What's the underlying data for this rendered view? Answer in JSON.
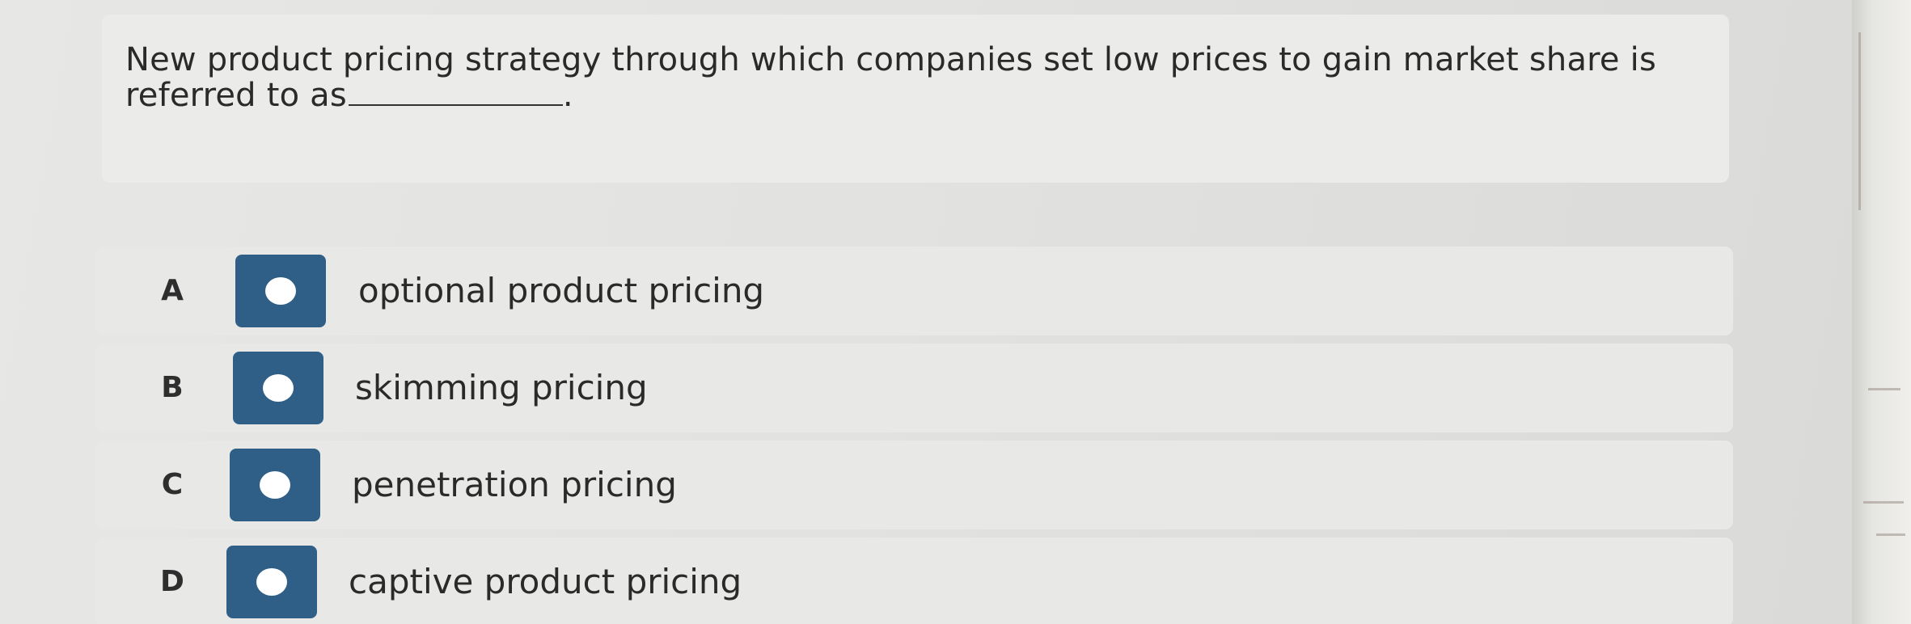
{
  "question": {
    "text": "New product pricing strategy through which companies set low prices to gain market share is referred to as",
    "trailing": "."
  },
  "options": [
    {
      "letter": "A",
      "label": "optional product pricing"
    },
    {
      "letter": "B",
      "label": "skimming pricing"
    },
    {
      "letter": "C",
      "label": "penetration pricing"
    },
    {
      "letter": "D",
      "label": "captive product pricing"
    }
  ],
  "colors": {
    "radio_box": "#2f5f86",
    "radio_dot": "#ffffff",
    "row_background": "#e8e8e6"
  }
}
